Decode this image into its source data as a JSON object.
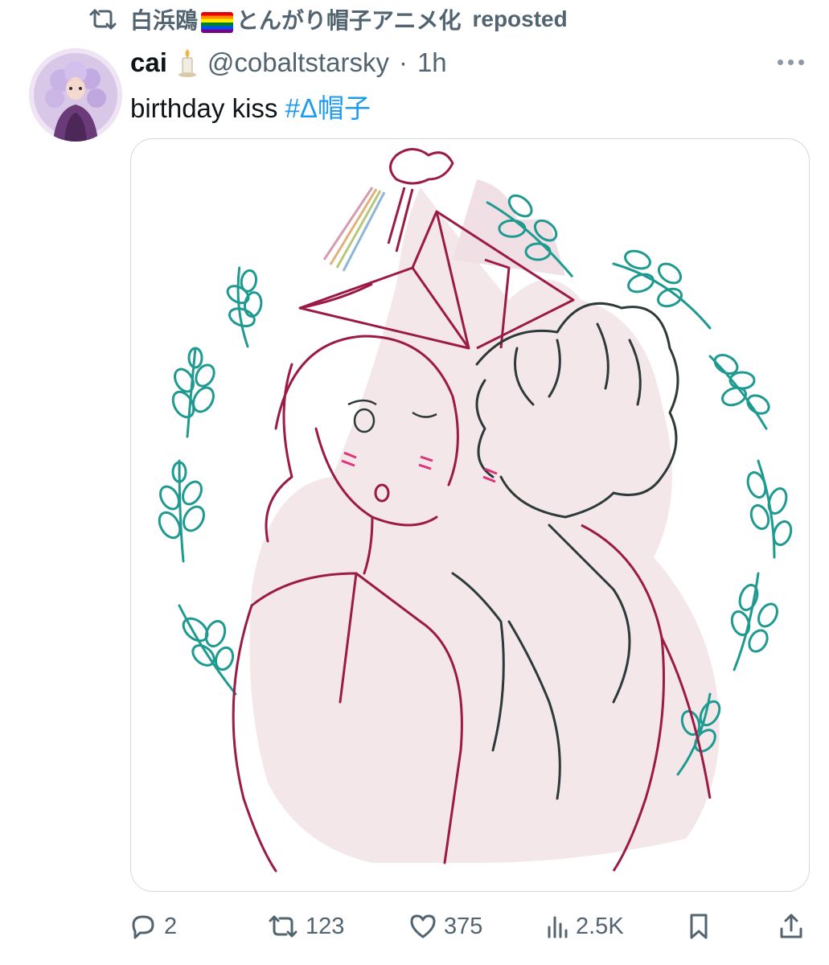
{
  "repost": {
    "user_prefix": "白浜鴎",
    "user_suffix": "とんがり帽子アニメ化",
    "action": "reposted",
    "icon": "repost-icon"
  },
  "tweet": {
    "display_name": "cai",
    "handle": "@cobaltstarsky",
    "separator": "·",
    "time": "1h",
    "text": "birthday kiss",
    "hashtag": "#Δ帽子",
    "media_alt": "Illustration of two characters in pointed hats, one kissing the other's cheek, surrounded by a wreath of leaves"
  },
  "actions": {
    "replies": "2",
    "reposts": "123",
    "likes": "375",
    "views": "2.5K"
  },
  "colors": {
    "text": "#0f1419",
    "secondary": "#536471",
    "link": "#1d9bf0",
    "line_red": "#9b1b45",
    "line_dark": "#2e3a3a",
    "leaf": "#1e9a90",
    "fill_pink": "#f3e7ea"
  }
}
